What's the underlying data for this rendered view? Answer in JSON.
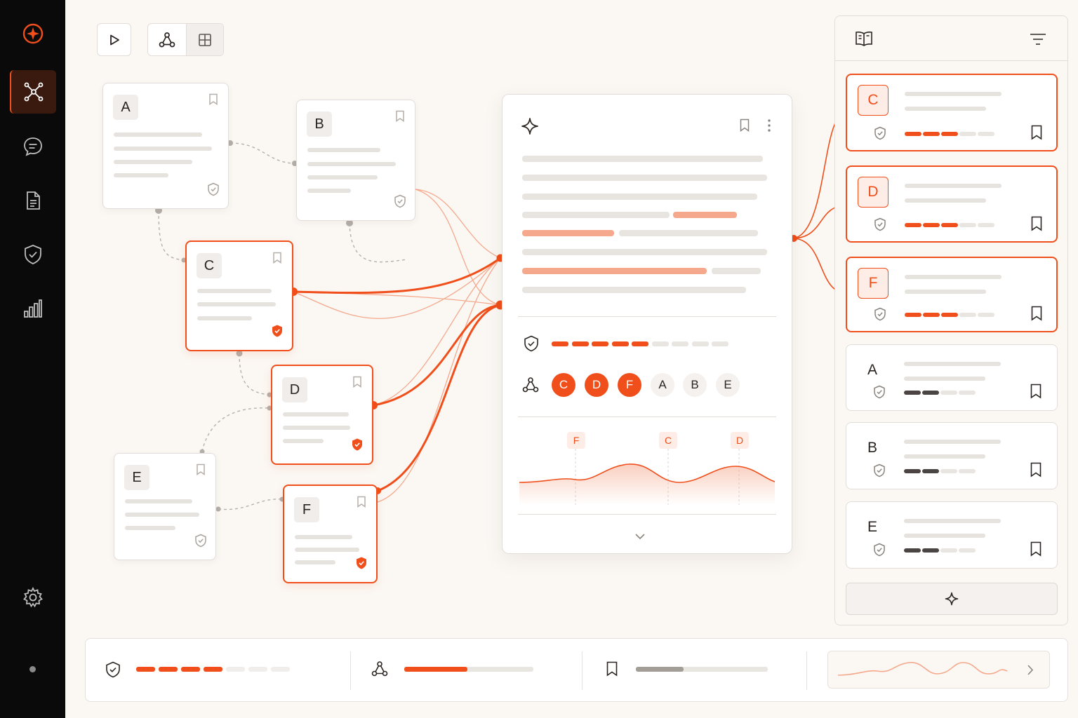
{
  "sidebar": {
    "icons": [
      "logo-icon",
      "graph-icon",
      "chat-icon",
      "document-icon",
      "shield-check-icon",
      "bar-chart-icon",
      "gear-icon"
    ]
  },
  "toolbar": {
    "icons": [
      "play-icon",
      "graph-view-icon",
      "grid-view-icon"
    ],
    "active_view": "graph-view"
  },
  "canvas": {
    "nodes": [
      {
        "id": "A",
        "label": "A",
        "selected": false
      },
      {
        "id": "B",
        "label": "B",
        "selected": false
      },
      {
        "id": "C",
        "label": "C",
        "selected": true
      },
      {
        "id": "D",
        "label": "D",
        "selected": true
      },
      {
        "id": "E",
        "label": "E",
        "selected": false
      },
      {
        "id": "F",
        "label": "F",
        "selected": true
      }
    ]
  },
  "detail": {
    "icons": [
      "sparkle-icon",
      "bookmark-icon",
      "more-icon",
      "shield-check-icon",
      "graph-icon",
      "chevron-down-icon"
    ],
    "score_filled": 5,
    "score_total": 9,
    "tags": [
      {
        "label": "C",
        "active": true
      },
      {
        "label": "D",
        "active": true
      },
      {
        "label": "F",
        "active": true
      },
      {
        "label": "A",
        "active": false
      },
      {
        "label": "B",
        "active": false
      },
      {
        "label": "E",
        "active": false
      }
    ],
    "timeline_markers": [
      "F",
      "C",
      "D"
    ]
  },
  "panel": {
    "icons": [
      "book-icon",
      "filter-icon",
      "sparkle-icon"
    ],
    "items": [
      {
        "label": "C",
        "selected": true,
        "filled": 3,
        "total": 5
      },
      {
        "label": "D",
        "selected": true,
        "filled": 3,
        "total": 5
      },
      {
        "label": "F",
        "selected": true,
        "filled": 3,
        "total": 5
      },
      {
        "label": "A",
        "selected": false,
        "filled": 2,
        "total": 4
      },
      {
        "label": "B",
        "selected": false,
        "filled": 2,
        "total": 4
      },
      {
        "label": "E",
        "selected": false,
        "filled": 2,
        "total": 4
      }
    ]
  },
  "status_bar": {
    "icons": [
      "shield-check-icon",
      "graph-icon",
      "bookmark-icon",
      "chevron-right-icon"
    ],
    "trust_filled": 4,
    "trust_total": 7,
    "graph_progress": 0.49,
    "bookmark_progress": 0.36
  },
  "colors": {
    "accent": "#F04E1A",
    "accent_light": "#F5A88C",
    "sidebar_bg": "#0A0A0A",
    "background": "#FBF8F4"
  }
}
